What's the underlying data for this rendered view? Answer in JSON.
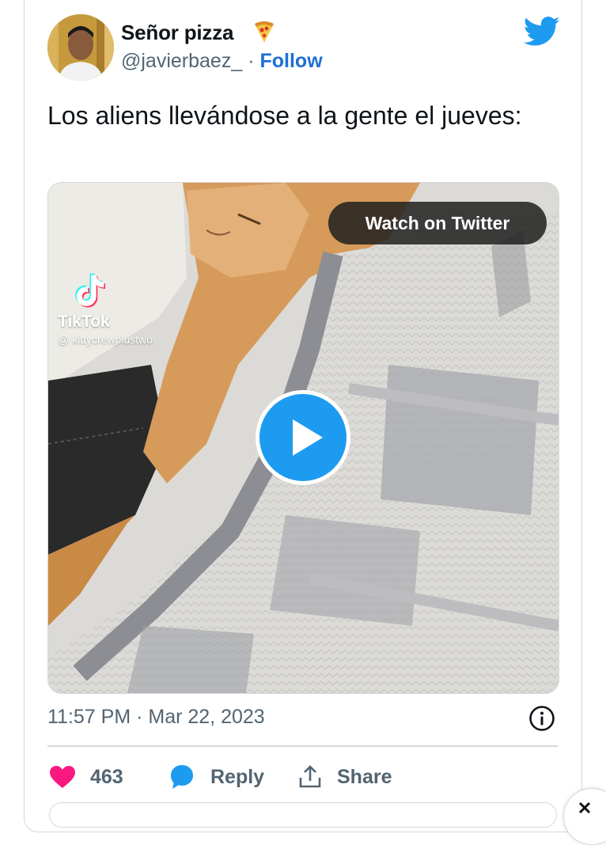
{
  "tweet": {
    "display_name": "Señor pizza",
    "handle": "@javierbaez_",
    "separator": "·",
    "follow_label": "Follow",
    "text": "Los aliens llevándose a la gente el jueves:",
    "timestamp": "11:57 PM · Mar 22, 2023"
  },
  "media": {
    "watch_label": "Watch on Twitter",
    "tiktok_brand": "TikTok",
    "tiktok_user": "@ kittycrewplustwo",
    "play_icon": "play-icon"
  },
  "actions": {
    "likes_count": "463",
    "reply_label": "Reply",
    "share_label": "Share"
  },
  "colors": {
    "twitter_blue": "#1d9bf0",
    "like_pink": "#f91880",
    "follow_blue": "#1d6fd6",
    "secondary_text": "#536471"
  }
}
